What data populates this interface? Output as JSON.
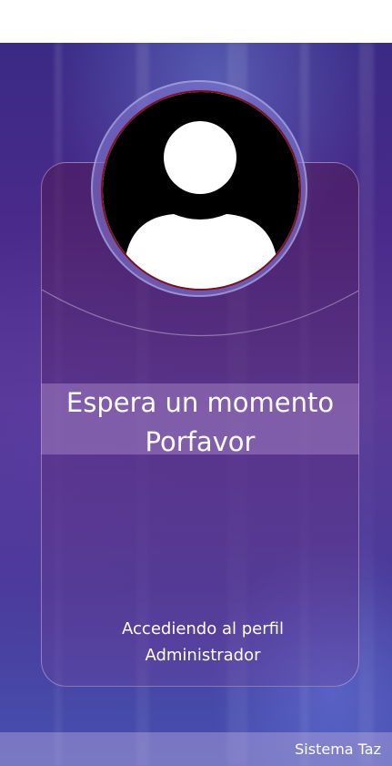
{
  "loading": {
    "message_line1": "Espera un momento",
    "message_line2": "Porfavor",
    "status_line1": "Accediendo al perfil",
    "status_line2": "Administrador"
  },
  "footer": {
    "system_name": "Sistema Taz"
  },
  "icons": {
    "avatar": "user-avatar-icon"
  },
  "colors": {
    "background_top": "#3a2a86",
    "background_bottom": "#4550b0",
    "avatar_border": "#7a1020",
    "text": "#ffffff"
  }
}
